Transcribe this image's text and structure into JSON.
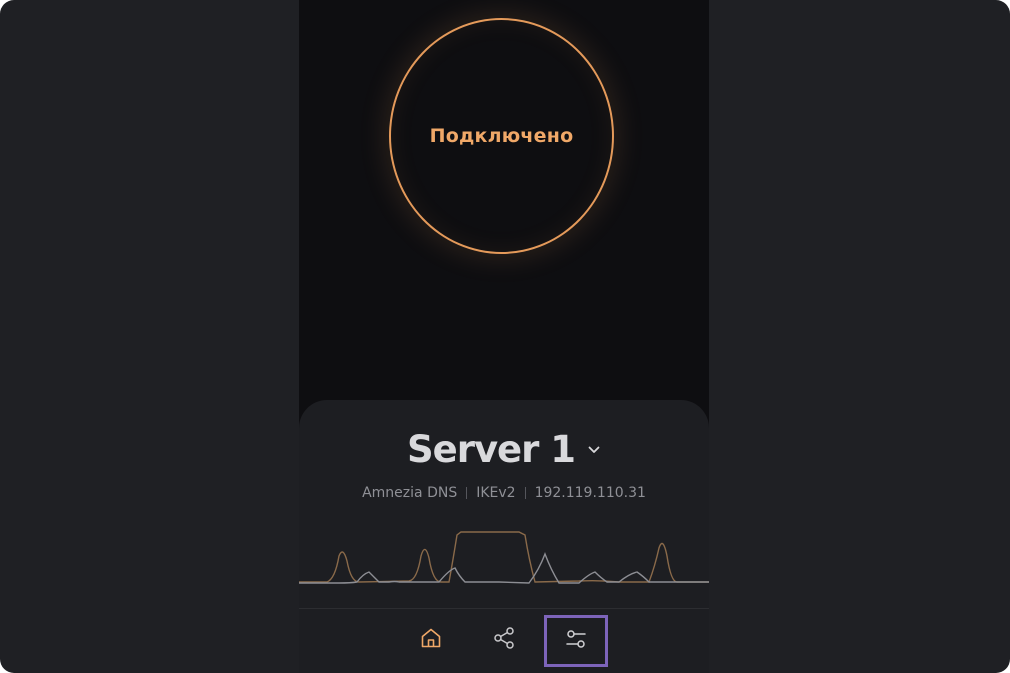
{
  "connection": {
    "status_label": "Подключено",
    "accent_color": "#e49a5a"
  },
  "server": {
    "name": "Server 1",
    "dns": "Amnezia DNS",
    "protocol": "IKEv2",
    "ip": "192.119.110.31"
  },
  "nav": {
    "items": [
      {
        "icon": "home-icon",
        "active": true
      },
      {
        "icon": "share-icon",
        "active": false
      },
      {
        "icon": "settings-sliders-icon",
        "active": false,
        "highlighted": true
      }
    ]
  },
  "colors": {
    "background": "#1f2024",
    "phone_background": "#0e0e11",
    "sheet_background": "#1d1e22",
    "accent": "#e49a5a",
    "highlight": "#7d64ba"
  }
}
